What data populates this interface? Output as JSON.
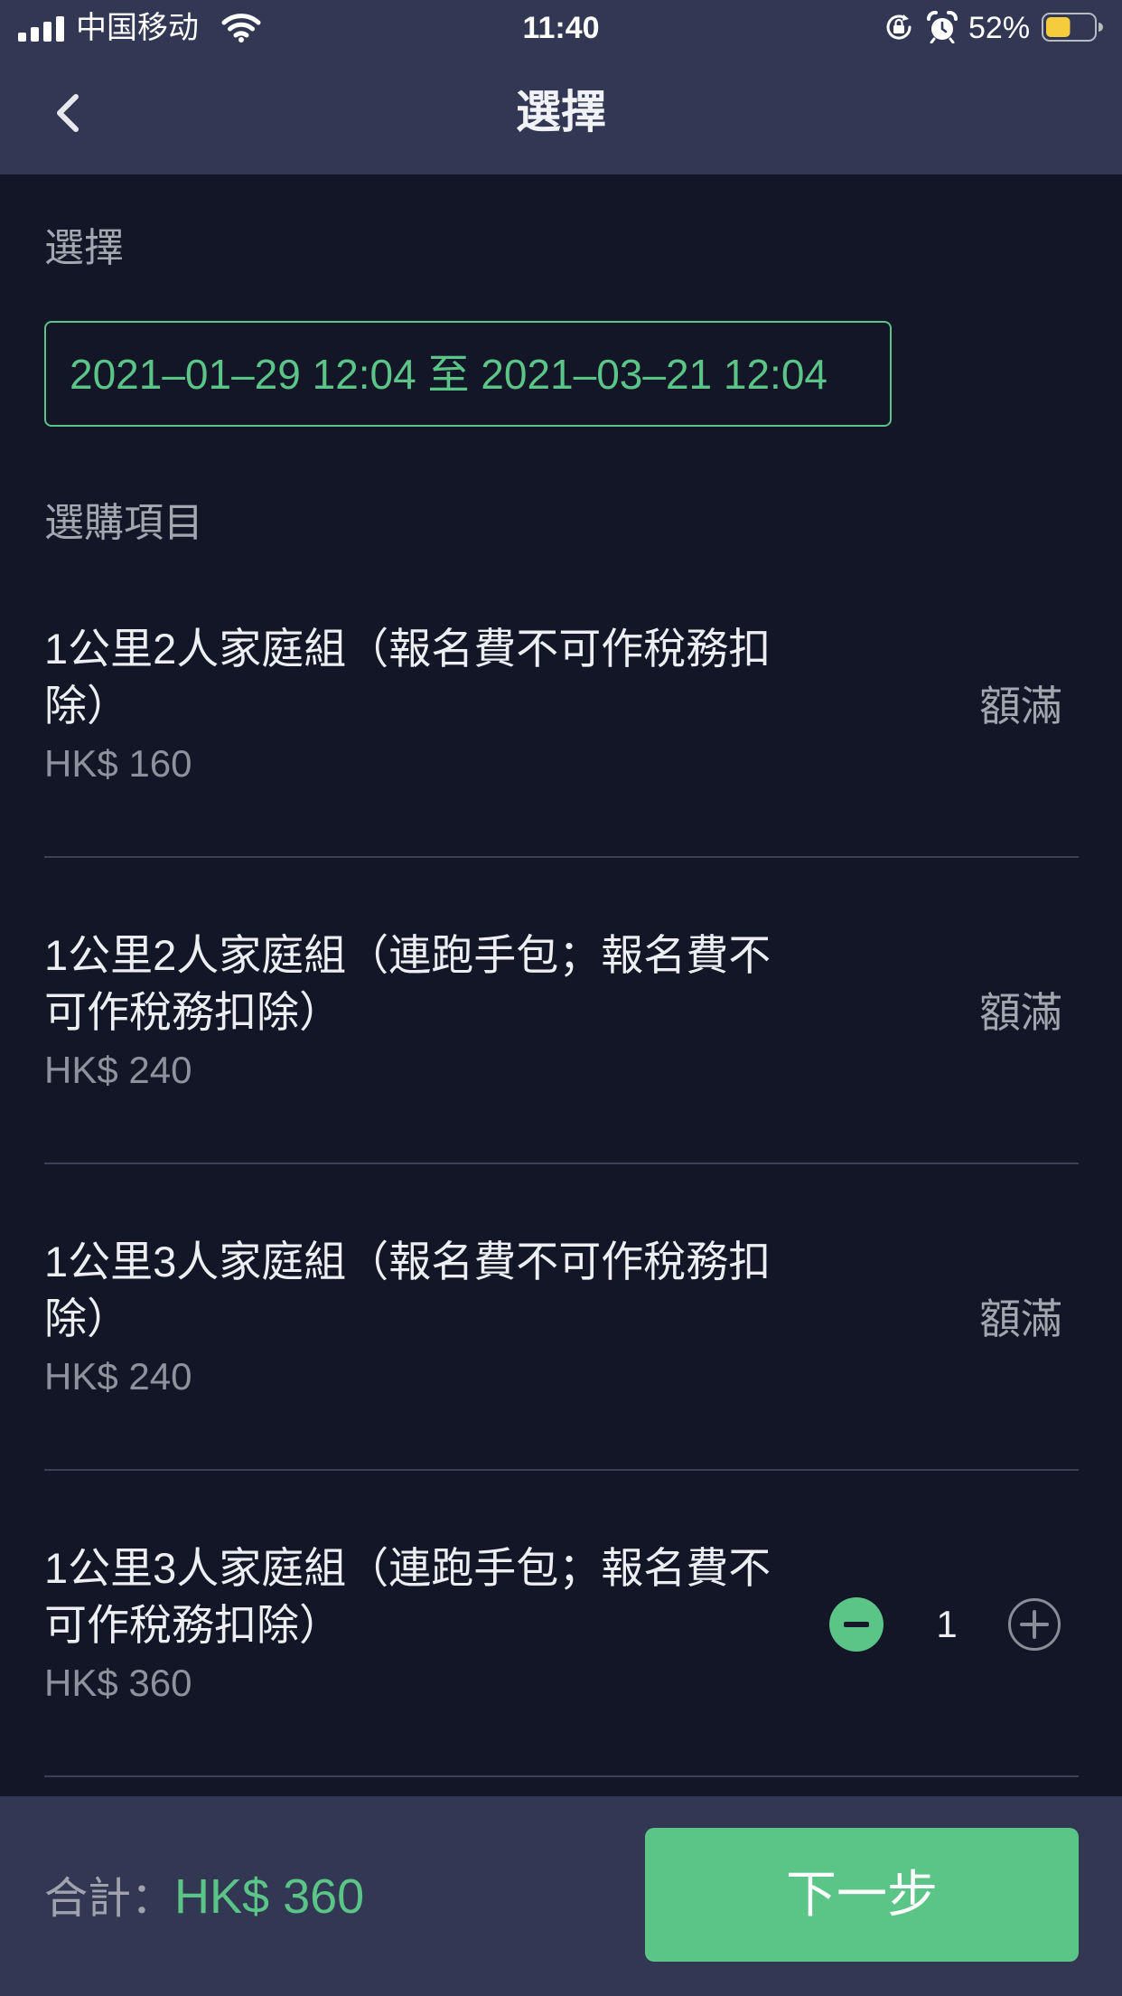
{
  "status_bar": {
    "carrier": "中国移动",
    "time": "11:40",
    "battery": "52%"
  },
  "header": {
    "title": "選擇"
  },
  "period": {
    "label": "選擇",
    "range": "2021–01–29 12:04 至 2021–03–21 12:04"
  },
  "items_section": {
    "label": "選購項目"
  },
  "items": [
    {
      "title": "1公里2人家庭組（報名費不可作稅務扣除）",
      "price": "HK$ 160",
      "status": "額滿"
    },
    {
      "title": "1公里2人家庭組（連跑手包；報名費不可作稅務扣除）",
      "price": "HK$ 240",
      "status": "額滿"
    },
    {
      "title": "1公里3人家庭組（報名費不可作稅務扣除）",
      "price": "HK$ 240",
      "status": "額滿"
    },
    {
      "title": "1公里3人家庭組（連跑手包；報名費不可作稅務扣除）",
      "price": "HK$ 360",
      "quantity": "1"
    }
  ],
  "footer": {
    "total_label": "合計：",
    "total_value": "HK$ 360",
    "next_button": "下一步"
  },
  "icons": {
    "back": "chevron-left-icon",
    "signal": "cellular-signal-icon",
    "wifi": "wifi-icon",
    "orientation_lock": "orientation-lock-icon",
    "alarm": "alarm-icon",
    "battery": "battery-icon",
    "decrement": "minus-icon",
    "increment": "plus-icon"
  },
  "colors": {
    "accent": "#5bc487",
    "header_background": "#323853",
    "page_background": "#131627",
    "battery_fill": "#f5cd3c"
  }
}
